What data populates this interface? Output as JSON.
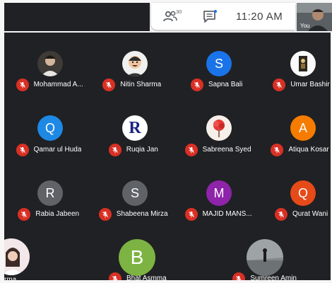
{
  "header": {
    "participant_count": "30",
    "time": "11:20 AM",
    "self_label": "You",
    "people_icon": "people-icon",
    "chat_icon": "chat-icon"
  },
  "colors": {
    "tile_background": "#202124",
    "muted_mic": "#d93025"
  },
  "participants": [
    {
      "name": "Mohammad A...",
      "avatar_type": "photo",
      "muted": true
    },
    {
      "name": "Nitin Sharma",
      "avatar_type": "photo",
      "muted": true
    },
    {
      "name": "Sapna Bali",
      "initial": "S",
      "color": "#1a73e8",
      "muted": true
    },
    {
      "name": "Umar Bashir",
      "avatar_type": "photo",
      "muted": true
    },
    {
      "name": "Qamar ul Huda",
      "initial": "Q",
      "color": "#1e88e5",
      "muted": true
    },
    {
      "name": "Ruqia Jan",
      "initial": "R",
      "color": "#ffffff",
      "text_color": "#1a237e",
      "muted": true
    },
    {
      "name": "Sabreena Syed",
      "avatar_type": "photo",
      "muted": true
    },
    {
      "name": "Atiqua Kosar",
      "initial": "A",
      "color": "#f57c00",
      "muted": true
    },
    {
      "name": "Rabia Jabeen",
      "initial": "R",
      "color": "#5f6368",
      "muted": true
    },
    {
      "name": "Shabeena Mirza",
      "initial": "S",
      "color": "#5f6368",
      "muted": true
    },
    {
      "name": "MAJID MANS...",
      "initial": "M",
      "color": "#8e24aa",
      "muted": true
    },
    {
      "name": "Qurat Wani",
      "initial": "Q",
      "color": "#e64a19",
      "muted": true
    },
    {
      "name": "rma",
      "avatar_type": "photo",
      "muted": false
    },
    {
      "name": "Bhat Asmma",
      "initial": "B",
      "color": "#7cb342",
      "muted": true
    },
    {
      "name": "Sumreen Amin",
      "avatar_type": "photo",
      "muted": true
    }
  ]
}
